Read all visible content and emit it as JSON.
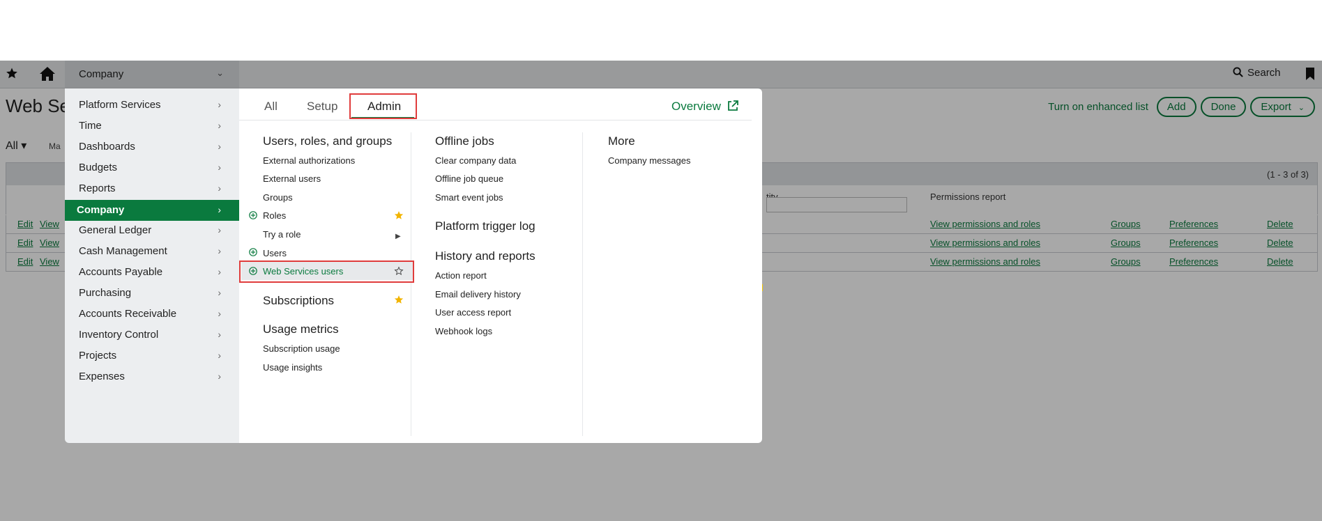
{
  "topbar": {
    "company_label": "Company",
    "search_label": "Search"
  },
  "page": {
    "title": "Web Se",
    "enhanced_list": "Turn on enhanced list",
    "add_label": "Add",
    "done_label": "Done",
    "export_label": "Export",
    "filter_label": "All",
    "filter_sub": "Ma",
    "count_label": "(1 - 3 of 3)",
    "col_partial": "tity",
    "col_permissions": "Permissions report",
    "rows": [
      {
        "edit": "Edit",
        "view": "View",
        "perm": "View permissions and roles",
        "groups": "Groups",
        "prefs": "Preferences",
        "delete": "Delete"
      },
      {
        "edit": "Edit",
        "view": "View",
        "perm": "View permissions and roles",
        "groups": "Groups",
        "prefs": "Preferences",
        "delete": "Delete"
      },
      {
        "edit": "Edit",
        "view": "View",
        "perm": "View permissions and roles",
        "groups": "Groups",
        "prefs": "Preferences",
        "delete": "Delete"
      }
    ]
  },
  "menu": {
    "left_items": [
      {
        "label": "Platform Services"
      },
      {
        "label": "Time"
      },
      {
        "label": "Dashboards"
      },
      {
        "label": "Budgets"
      },
      {
        "label": "Reports"
      },
      {
        "label": "Company"
      },
      {
        "label": "General Ledger"
      },
      {
        "label": "Cash Management"
      },
      {
        "label": "Accounts Payable"
      },
      {
        "label": "Purchasing"
      },
      {
        "label": "Accounts Receivable"
      },
      {
        "label": "Inventory Control"
      },
      {
        "label": "Projects"
      },
      {
        "label": "Expenses"
      }
    ],
    "tabs": {
      "all": "All",
      "setup": "Setup",
      "admin": "Admin"
    },
    "overview": "Overview",
    "col1": {
      "heading": "Users, roles, and groups",
      "items": [
        "External authorizations",
        "External users",
        "Groups",
        "Roles",
        "Try a role",
        "Users",
        "Web Services users"
      ],
      "subscriptions": "Subscriptions",
      "usage_heading": "Usage metrics",
      "usage_items": [
        "Subscription usage",
        "Usage insights"
      ]
    },
    "col2": {
      "offline_heading": "Offline jobs",
      "offline_items": [
        "Clear company data",
        "Offline job queue",
        "Smart event jobs"
      ],
      "trigger_heading": "Platform trigger log",
      "history_heading": "History and reports",
      "history_items": [
        "Action report",
        "Email delivery history",
        "User access report",
        "Webhook logs"
      ]
    },
    "col3": {
      "heading": "More",
      "items": [
        "Company messages"
      ]
    }
  },
  "colors": {
    "accent": "#0a7a3e",
    "highlight_box": "#e03c3c",
    "favorite_star": "#f2b400"
  }
}
